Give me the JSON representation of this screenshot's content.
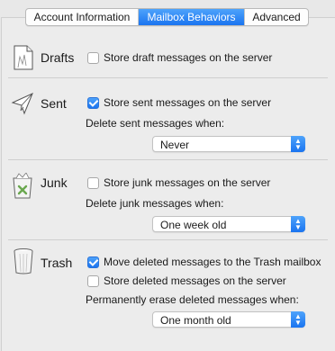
{
  "tabs": [
    {
      "label": "Account Information",
      "active": false
    },
    {
      "label": "Mailbox Behaviors",
      "active": true
    },
    {
      "label": "Advanced",
      "active": false
    }
  ],
  "sections": {
    "drafts": {
      "label": "Drafts",
      "icon": "drafts-page-icon",
      "store_checkbox": {
        "label": "Store draft messages on the server",
        "checked": false
      }
    },
    "sent": {
      "label": "Sent",
      "icon": "paper-plane-icon",
      "store_checkbox": {
        "label": "Store sent messages on the server",
        "checked": true
      },
      "delete_label": "Delete sent messages when:",
      "delete_popup": {
        "value": "Never"
      }
    },
    "junk": {
      "label": "Junk",
      "icon": "junk-bin-icon",
      "store_checkbox": {
        "label": "Store junk messages on the server",
        "checked": false
      },
      "delete_label": "Delete junk messages when:",
      "delete_popup": {
        "value": "One week old"
      }
    },
    "trash": {
      "label": "Trash",
      "icon": "trash-can-icon",
      "move_checkbox": {
        "label": "Move deleted messages to the Trash mailbox",
        "checked": true
      },
      "store_checkbox": {
        "label": "Store deleted messages on the server",
        "checked": false
      },
      "erase_label": "Permanently erase deleted messages when:",
      "erase_popup": {
        "value": "One month old"
      }
    }
  },
  "colors": {
    "accent": "#1a74f0",
    "background": "#ececec"
  }
}
